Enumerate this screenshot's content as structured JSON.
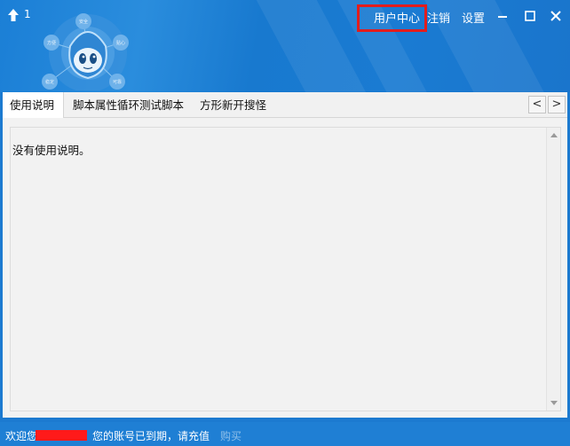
{
  "window": {
    "title": "1",
    "accent_color": "#1c7ad0"
  },
  "mascot_labels": [
    "安全",
    "方便",
    "贴心",
    "稳定",
    "可靠"
  ],
  "nav": {
    "user_center": "用户中心",
    "logout": "注销",
    "settings": "设置"
  },
  "tabs": [
    {
      "label": "使用说明",
      "active": true
    },
    {
      "label": "脚本属性循环测试脚本",
      "active": false
    },
    {
      "label": "方形新开搜怪",
      "active": false
    }
  ],
  "tab_arrows": {
    "prev": "<",
    "next": ">"
  },
  "content": {
    "text": "没有使用说明。"
  },
  "status": {
    "welcome": "欢迎您",
    "message": "您的账号已到期，请充值",
    "buy": "购买"
  }
}
